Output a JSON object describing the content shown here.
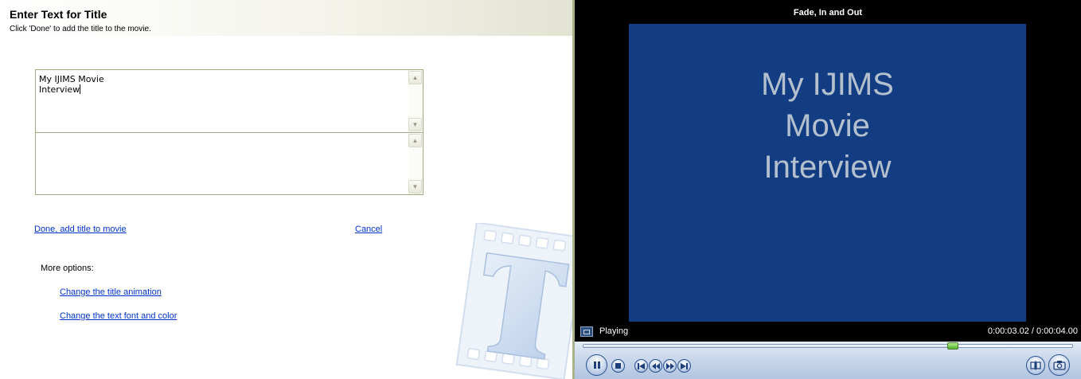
{
  "editor": {
    "title": "Enter Text for Title",
    "subtitle": "Click 'Done' to add the title to the movie.",
    "title_text": "My IJIMS Movie\nInterview",
    "subtitle_text": "",
    "done_link": "Done, add title to movie",
    "cancel_link": "Cancel",
    "more_options_label": "More options:",
    "options": [
      {
        "label": "Change the title animation"
      },
      {
        "label": "Change the text font and color"
      }
    ]
  },
  "preview": {
    "title": "Fade, In and Out",
    "frame_lines": [
      "My IJIMS",
      "Movie",
      "Interview"
    ],
    "frame_color": "#123d82",
    "status": "Playing",
    "time": "0:00:03.02 / 0:00:04.00",
    "progress_fraction": 0.755
  },
  "icons": {
    "pause": "pause-icon",
    "stop": "stop-icon",
    "previous": "previous-icon",
    "rewind": "rewind-icon",
    "fast_forward": "fast-forward-icon",
    "next": "next-icon",
    "split": "split-clip-icon",
    "snapshot": "camera-icon"
  },
  "colors": {
    "link": "#0033cc",
    "accent_border": "#a9b38a"
  }
}
